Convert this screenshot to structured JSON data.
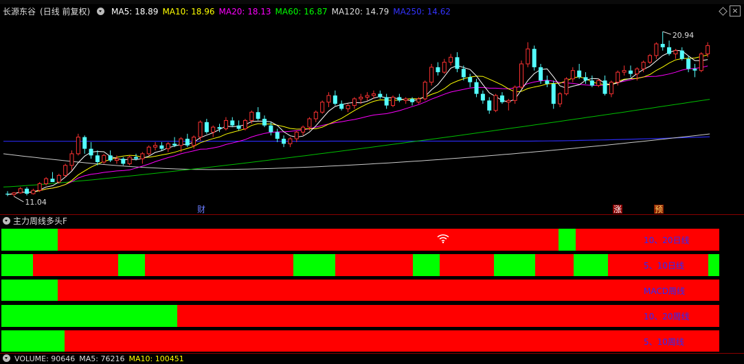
{
  "stock": {
    "name": "长源东谷",
    "mode": "(日线 前复权)"
  },
  "ma_legend": [
    {
      "label": "MA5: 18.89",
      "color": "#ffffff"
    },
    {
      "label": "MA10: 18.96",
      "color": "#ffff00"
    },
    {
      "label": "MA20: 18.13",
      "color": "#ff00ff"
    },
    {
      "label": "MA60: 16.87",
      "color": "#00ff00"
    },
    {
      "label": "MA120: 14.79",
      "color": "#dddddd"
    },
    {
      "label": "MA250: 14.62",
      "color": "#3333ff"
    }
  ],
  "chart_data": {
    "type": "candlestick",
    "ylim": [
      10.5,
      21.6
    ],
    "high_label": "20.94",
    "low_label": "11.04",
    "candles": [
      [
        11.2,
        11.35,
        11.05,
        11.15
      ],
      [
        11.15,
        11.3,
        11.04,
        11.25
      ],
      [
        11.25,
        11.6,
        11.2,
        11.5
      ],
      [
        11.5,
        11.6,
        11.1,
        11.2
      ],
      [
        11.2,
        11.5,
        11.15,
        11.4
      ],
      [
        11.4,
        11.9,
        11.3,
        11.8
      ],
      [
        11.8,
        12.2,
        11.7,
        12.1
      ],
      [
        12.1,
        12.5,
        11.9,
        11.9
      ],
      [
        11.9,
        12.4,
        11.8,
        12.3
      ],
      [
        12.3,
        13.0,
        12.2,
        12.9
      ],
      [
        12.9,
        13.8,
        12.6,
        13.6
      ],
      [
        13.6,
        14.8,
        13.5,
        14.6
      ],
      [
        14.6,
        14.7,
        13.6,
        13.9
      ],
      [
        13.9,
        14.3,
        13.3,
        13.5
      ],
      [
        13.5,
        13.8,
        12.9,
        13.1
      ],
      [
        13.1,
        13.6,
        13.0,
        13.5
      ],
      [
        13.5,
        13.8,
        13.1,
        13.2
      ],
      [
        13.2,
        13.5,
        13.0,
        13.3
      ],
      [
        13.3,
        13.4,
        12.9,
        13.0
      ],
      [
        13.0,
        13.5,
        12.9,
        13.4
      ],
      [
        13.4,
        13.6,
        13.2,
        13.3
      ],
      [
        13.3,
        13.7,
        13.0,
        13.6
      ],
      [
        13.6,
        14.1,
        13.5,
        14.0
      ],
      [
        14.0,
        14.3,
        13.8,
        14.1
      ],
      [
        14.1,
        14.3,
        13.8,
        13.9
      ],
      [
        13.9,
        14.3,
        13.7,
        14.2
      ],
      [
        14.2,
        14.6,
        14.0,
        14.1
      ],
      [
        14.1,
        14.6,
        13.7,
        14.5
      ],
      [
        14.5,
        14.8,
        14.0,
        14.1
      ],
      [
        14.1,
        14.7,
        13.9,
        14.6
      ],
      [
        14.6,
        15.6,
        14.4,
        15.5
      ],
      [
        15.5,
        15.7,
        14.8,
        14.9
      ],
      [
        14.9,
        15.3,
        14.6,
        15.2
      ],
      [
        15.2,
        15.4,
        14.9,
        15.1
      ],
      [
        15.1,
        15.8,
        15.0,
        15.6
      ],
      [
        15.6,
        15.8,
        15.2,
        15.3
      ],
      [
        15.3,
        15.6,
        15.0,
        15.1
      ],
      [
        15.1,
        15.7,
        15.0,
        15.6
      ],
      [
        15.6,
        16.2,
        15.4,
        16.1
      ],
      [
        16.1,
        16.4,
        15.6,
        15.7
      ],
      [
        15.7,
        15.9,
        15.2,
        15.3
      ],
      [
        15.3,
        15.5,
        14.7,
        14.9
      ],
      [
        14.9,
        15.1,
        14.3,
        14.5
      ],
      [
        14.5,
        14.7,
        14.0,
        14.2
      ],
      [
        14.2,
        14.6,
        14.0,
        14.5
      ],
      [
        14.5,
        15.0,
        14.3,
        14.9
      ],
      [
        14.9,
        15.3,
        14.7,
        15.2
      ],
      [
        15.2,
        15.8,
        15.0,
        15.7
      ],
      [
        15.7,
        16.2,
        15.5,
        16.1
      ],
      [
        16.1,
        16.8,
        16.0,
        16.7
      ],
      [
        16.7,
        17.3,
        16.4,
        17.1
      ],
      [
        17.1,
        17.4,
        16.5,
        16.6
      ],
      [
        16.6,
        16.8,
        16.2,
        16.3
      ],
      [
        16.3,
        16.6,
        16.1,
        16.5
      ],
      [
        16.5,
        17.0,
        16.3,
        16.9
      ],
      [
        16.9,
        17.2,
        16.6,
        17.0
      ],
      [
        17.0,
        17.3,
        16.8,
        17.1
      ],
      [
        17.1,
        17.4,
        16.9,
        17.2
      ],
      [
        17.2,
        17.4,
        16.9,
        17.0
      ],
      [
        17.0,
        17.2,
        16.3,
        16.5
      ],
      [
        16.5,
        17.1,
        16.4,
        17.0
      ],
      [
        17.0,
        17.2,
        16.7,
        16.8
      ],
      [
        16.8,
        17.0,
        16.6,
        16.9
      ],
      [
        16.9,
        17.0,
        16.5,
        16.7
      ],
      [
        16.7,
        17.0,
        16.6,
        16.9
      ],
      [
        16.9,
        18.0,
        16.8,
        17.9
      ],
      [
        17.9,
        19.0,
        17.7,
        18.8
      ],
      [
        18.8,
        19.1,
        18.3,
        18.5
      ],
      [
        18.5,
        19.3,
        18.4,
        19.1
      ],
      [
        19.1,
        19.6,
        18.9,
        19.4
      ],
      [
        19.4,
        19.7,
        18.5,
        18.7
      ],
      [
        18.7,
        18.9,
        18.0,
        18.2
      ],
      [
        18.2,
        18.4,
        17.6,
        17.9
      ],
      [
        17.9,
        18.1,
        17.0,
        17.2
      ],
      [
        17.2,
        17.4,
        16.6,
        16.8
      ],
      [
        16.8,
        17.0,
        16.0,
        16.2
      ],
      [
        16.2,
        17.2,
        16.1,
        17.1
      ],
      [
        17.1,
        17.3,
        16.6,
        16.7
      ],
      [
        16.7,
        16.9,
        16.2,
        16.8
      ],
      [
        16.8,
        17.7,
        16.6,
        17.6
      ],
      [
        17.6,
        19.2,
        17.5,
        19.0
      ],
      [
        19.0,
        20.3,
        18.8,
        19.9
      ],
      [
        19.9,
        20.1,
        18.6,
        18.8
      ],
      [
        18.8,
        19.0,
        17.8,
        18.0
      ],
      [
        18.0,
        18.3,
        17.6,
        17.8
      ],
      [
        17.8,
        18.0,
        16.3,
        16.6
      ],
      [
        16.6,
        17.3,
        16.4,
        17.2
      ],
      [
        17.2,
        18.2,
        17.1,
        18.1
      ],
      [
        18.1,
        18.8,
        17.9,
        18.6
      ],
      [
        18.6,
        19.0,
        18.1,
        18.2
      ],
      [
        18.2,
        18.5,
        17.8,
        18.0
      ],
      [
        18.0,
        18.3,
        17.6,
        17.7
      ],
      [
        17.7,
        18.1,
        17.6,
        18.0
      ],
      [
        18.0,
        18.3,
        17.1,
        17.2
      ],
      [
        17.2,
        18.0,
        17.0,
        17.9
      ],
      [
        17.9,
        18.6,
        17.7,
        18.5
      ],
      [
        18.5,
        18.9,
        18.3,
        18.6
      ],
      [
        18.6,
        18.9,
        18.2,
        18.4
      ],
      [
        18.4,
        18.8,
        18.0,
        18.7
      ],
      [
        18.7,
        19.2,
        18.5,
        19.1
      ],
      [
        19.1,
        19.6,
        19.0,
        19.5
      ],
      [
        19.5,
        20.3,
        19.3,
        20.2
      ],
      [
        20.2,
        20.94,
        19.8,
        20.0
      ],
      [
        20.0,
        20.4,
        19.5,
        19.6
      ],
      [
        19.6,
        19.9,
        19.3,
        19.8
      ],
      [
        19.8,
        20.0,
        19.2,
        19.3
      ],
      [
        19.3,
        19.5,
        18.5,
        18.7
      ],
      [
        18.7,
        19.0,
        18.2,
        18.6
      ],
      [
        18.6,
        19.7,
        18.5,
        19.6
      ],
      [
        19.6,
        20.3,
        19.4,
        20.1
      ]
    ],
    "ma_periods": [
      5,
      10,
      20,
      60,
      120,
      250
    ],
    "ma_colors": [
      "#ffffff",
      "#ffff00",
      "#ff00ff",
      "#00c000",
      "#cccccc",
      "#2a2aee"
    ],
    "ma250_levels": [
      14.35,
      14.35,
      14.36,
      14.62
    ],
    "ma120_start_end": [
      13.6,
      14.79
    ],
    "ma60_start_end": [
      11.6,
      16.87
    ],
    "event_tags": [
      {
        "text": "财",
        "color": "#6a7cff",
        "bg": "none"
      },
      {
        "text": "涨",
        "color": "#ffffff",
        "bg": "#8b0000"
      },
      {
        "text": "预",
        "color": "#ffd060",
        "bg": "#8b2000"
      }
    ]
  },
  "indicator": {
    "title": "主力周线多头F",
    "rows": [
      {
        "label": "10、20日线",
        "green": [
          [
            0,
            0.078
          ],
          [
            0.776,
            0.8
          ]
        ]
      },
      {
        "label": "5、10日线",
        "green": [
          [
            0,
            0.044
          ],
          [
            0.163,
            0.2
          ],
          [
            0.407,
            0.465
          ],
          [
            0.573,
            0.611
          ],
          [
            0.686,
            0.744
          ],
          [
            0.797,
            0.845
          ],
          [
            0.985,
            1.0
          ]
        ]
      },
      {
        "label": "MACD周线",
        "green": [
          [
            0,
            0.078
          ]
        ]
      },
      {
        "label": "10、20周线",
        "green": [
          [
            0,
            0.245
          ]
        ]
      },
      {
        "label": "5、10周线",
        "green": [
          [
            0,
            0.088
          ]
        ]
      }
    ]
  },
  "volume": {
    "volume": "VOLUME: 90646",
    "ma5": "MA5: 76216",
    "ma10": "MA10: 100451"
  }
}
